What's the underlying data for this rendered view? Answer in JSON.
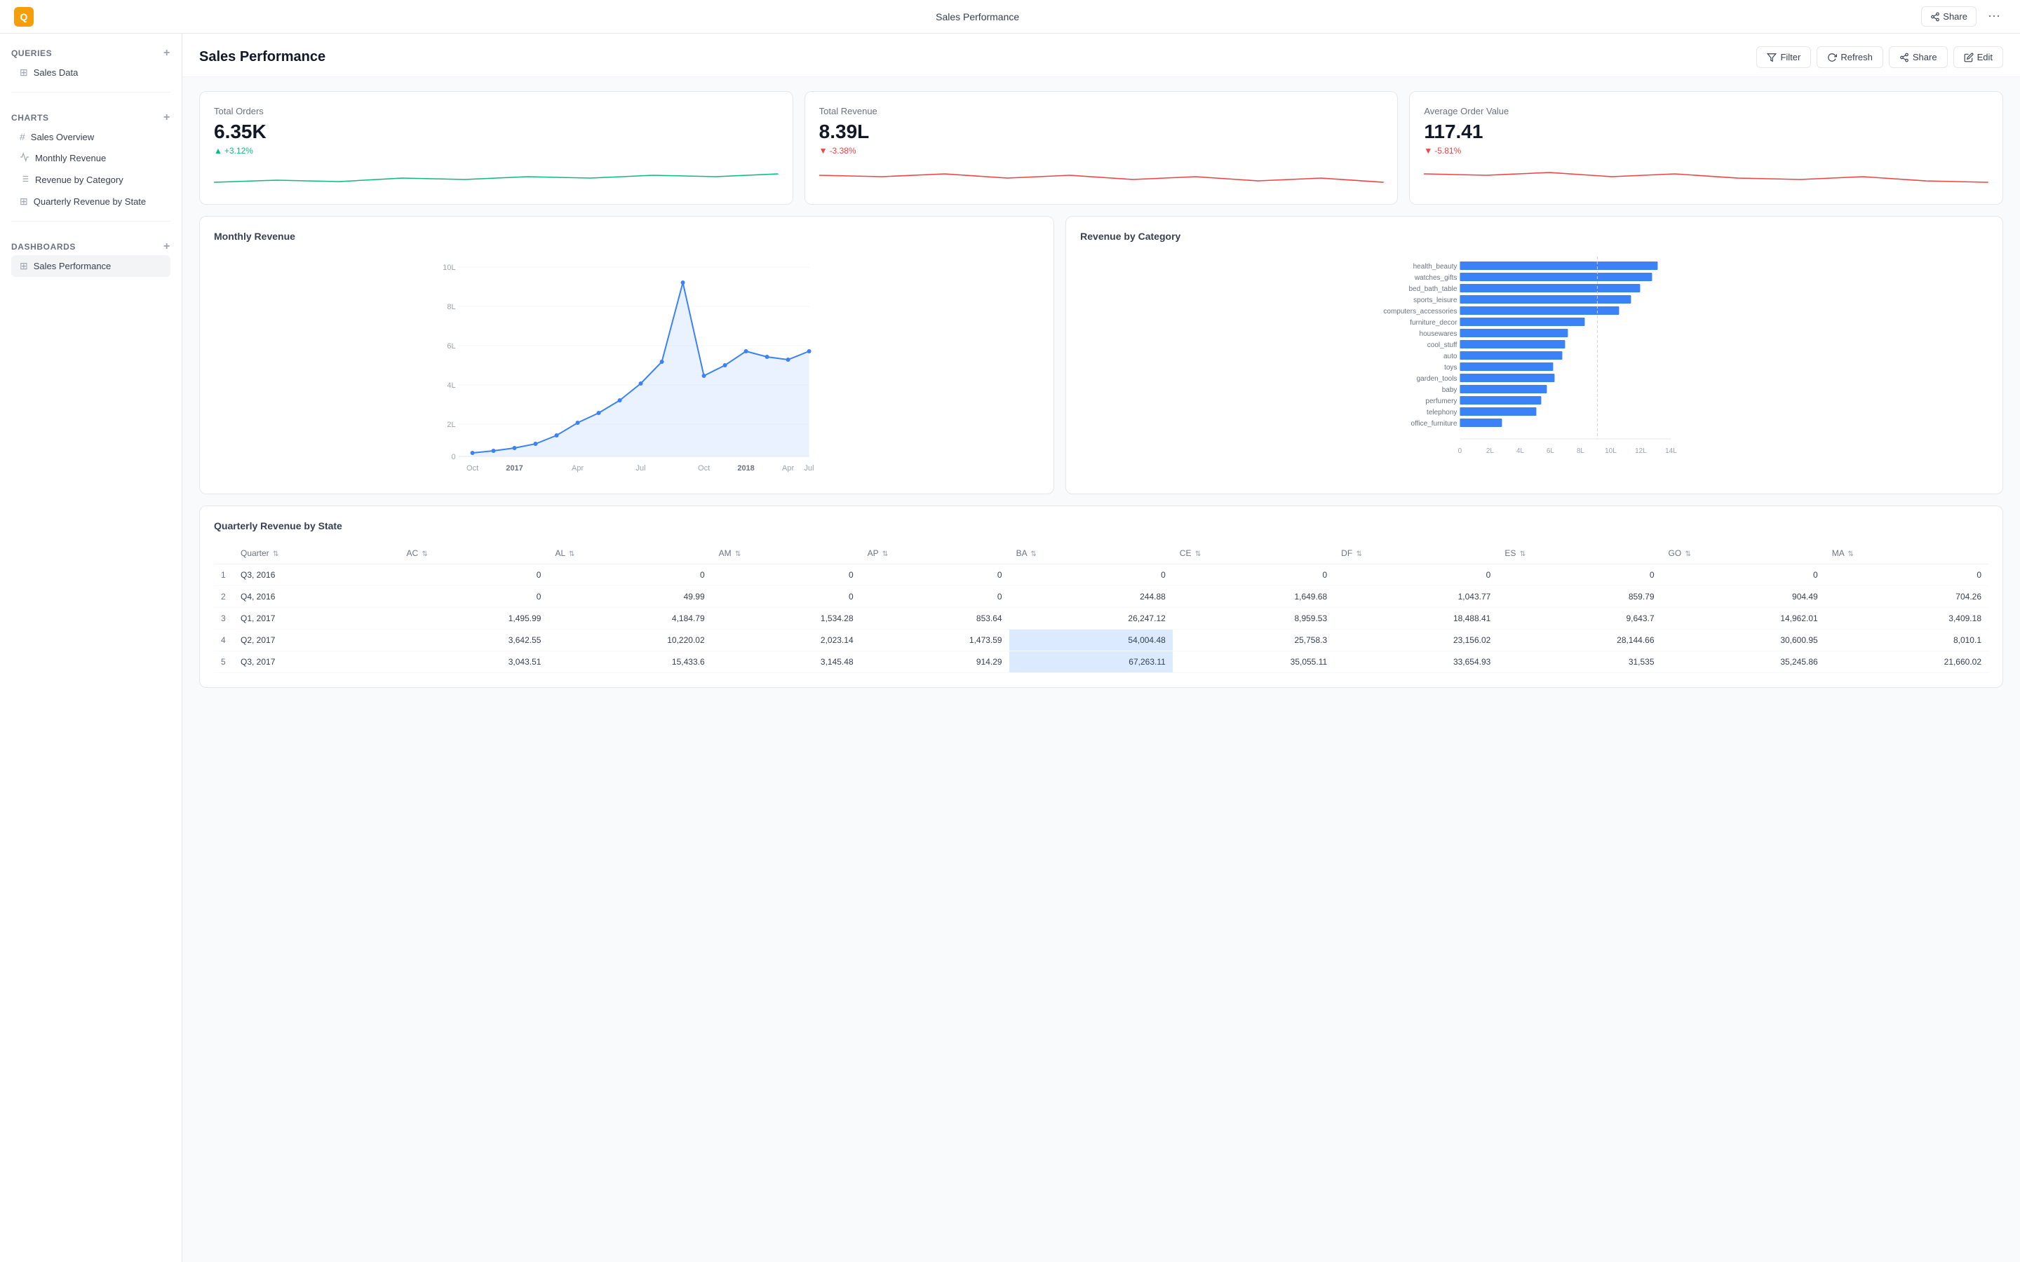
{
  "app": {
    "logo_text": "Q",
    "title": "Sales Performance"
  },
  "topbar": {
    "share_label": "Share",
    "more_label": "⋯"
  },
  "sidebar": {
    "queries_label": "Queries",
    "queries_items": [
      {
        "id": "sales-data",
        "label": "Sales Data",
        "icon": "⊞"
      }
    ],
    "charts_label": "Charts",
    "charts_items": [
      {
        "id": "sales-overview",
        "label": "Sales Overview",
        "icon": "#"
      },
      {
        "id": "monthly-revenue",
        "label": "Monthly Revenue",
        "icon": "📈"
      },
      {
        "id": "revenue-by-category",
        "label": "Revenue by Category",
        "icon": "☰"
      },
      {
        "id": "quarterly-revenue-by-state",
        "label": "Quarterly Revenue by State",
        "icon": "⊞"
      }
    ],
    "dashboards_label": "Dashboards",
    "dashboards_items": [
      {
        "id": "sales-performance",
        "label": "Sales Performance",
        "icon": "⊞",
        "active": true
      }
    ]
  },
  "dashboard": {
    "title": "Sales Performance",
    "filter_label": "Filter",
    "refresh_label": "Refresh",
    "share_label": "Share",
    "edit_label": "Edit"
  },
  "kpi": [
    {
      "id": "total-orders",
      "label": "Total Orders",
      "value": "6.35K",
      "change": "+3.12%",
      "positive": true
    },
    {
      "id": "total-revenue",
      "label": "Total Revenue",
      "value": "8.39L",
      "change": "-3.38%",
      "positive": false
    },
    {
      "id": "avg-order-value",
      "label": "Average Order Value",
      "value": "117.41",
      "change": "-5.81%",
      "positive": false
    }
  ],
  "monthly_revenue": {
    "title": "Monthly Revenue",
    "x_labels": [
      "Oct",
      "2017",
      "Apr",
      "Jul",
      "Oct",
      "2018",
      "Apr",
      "Jul"
    ],
    "y_labels": [
      "0",
      "2L",
      "4L",
      "6L",
      "8L",
      "10L"
    ]
  },
  "revenue_by_category": {
    "title": "Revenue by Category",
    "x_labels": [
      "0",
      "2L",
      "4L",
      "6L",
      "8L",
      "10L",
      "12L",
      "14L"
    ],
    "categories": [
      {
        "name": "health_beauty",
        "value": 13.2
      },
      {
        "name": "watches_gifts",
        "value": 12.8
      },
      {
        "name": "bed_bath_table",
        "value": 12.0
      },
      {
        "name": "sports_leisure",
        "value": 11.4
      },
      {
        "name": "computers_accessories",
        "value": 10.6
      },
      {
        "name": "furniture_decor",
        "value": 8.3
      },
      {
        "name": "housewares",
        "value": 7.2
      },
      {
        "name": "cool_stuff",
        "value": 7.0
      },
      {
        "name": "auto",
        "value": 6.8
      },
      {
        "name": "toys",
        "value": 6.2
      },
      {
        "name": "garden_tools",
        "value": 6.3
      },
      {
        "name": "baby",
        "value": 5.8
      },
      {
        "name": "perfumery",
        "value": 5.4
      },
      {
        "name": "telephony",
        "value": 5.1
      },
      {
        "name": "office_furniture",
        "value": 2.8
      }
    ]
  },
  "quarterly_table": {
    "title": "Quarterly Revenue by State",
    "columns": [
      "Quarter",
      "AC",
      "AL",
      "AM",
      "AP",
      "BA",
      "CE",
      "DF",
      "ES",
      "GO",
      "MA"
    ],
    "rows": [
      {
        "num": 1,
        "quarter": "Q3, 2016",
        "AC": "0",
        "AL": "0",
        "AM": "0",
        "AP": "0",
        "BA": "0",
        "CE": "0",
        "DF": "0",
        "ES": "0",
        "GO": "0",
        "MA": "0",
        "highlight": false
      },
      {
        "num": 2,
        "quarter": "Q4, 2016",
        "AC": "0",
        "AL": "49.99",
        "AM": "0",
        "AP": "0",
        "BA": "244.88",
        "CE": "1,649.68",
        "DF": "1,043.77",
        "ES": "859.79",
        "GO": "904.49",
        "MA": "704.26",
        "highlight": false
      },
      {
        "num": 3,
        "quarter": "Q1, 2017",
        "AC": "1,495.99",
        "AL": "4,184.79",
        "AM": "1,534.28",
        "AP": "853.64",
        "BA": "26,247.12",
        "CE": "8,959.53",
        "DF": "18,488.41",
        "ES": "9,643.7",
        "GO": "14,962.01",
        "MA": "3,409.18",
        "highlight": false
      },
      {
        "num": 4,
        "quarter": "Q2, 2017",
        "AC": "3,642.55",
        "AL": "10,220.02",
        "AM": "2,023.14",
        "AP": "1,473.59",
        "BA": "54,004.48",
        "CE": "25,758.3",
        "DF": "23,156.02",
        "ES": "28,144.66",
        "GO": "30,600.95",
        "MA": "8,010.1",
        "highlight_ba": true
      },
      {
        "num": 5,
        "quarter": "Q3, 2017",
        "AC": "3,043.51",
        "AL": "15,433.6",
        "AM": "3,145.48",
        "AP": "914.29",
        "BA": "67,263.11",
        "CE": "35,055.11",
        "DF": "33,654.93",
        "ES": "31,535",
        "GO": "35,245.86",
        "MA": "21,660.02",
        "highlight_ba": true
      }
    ]
  }
}
